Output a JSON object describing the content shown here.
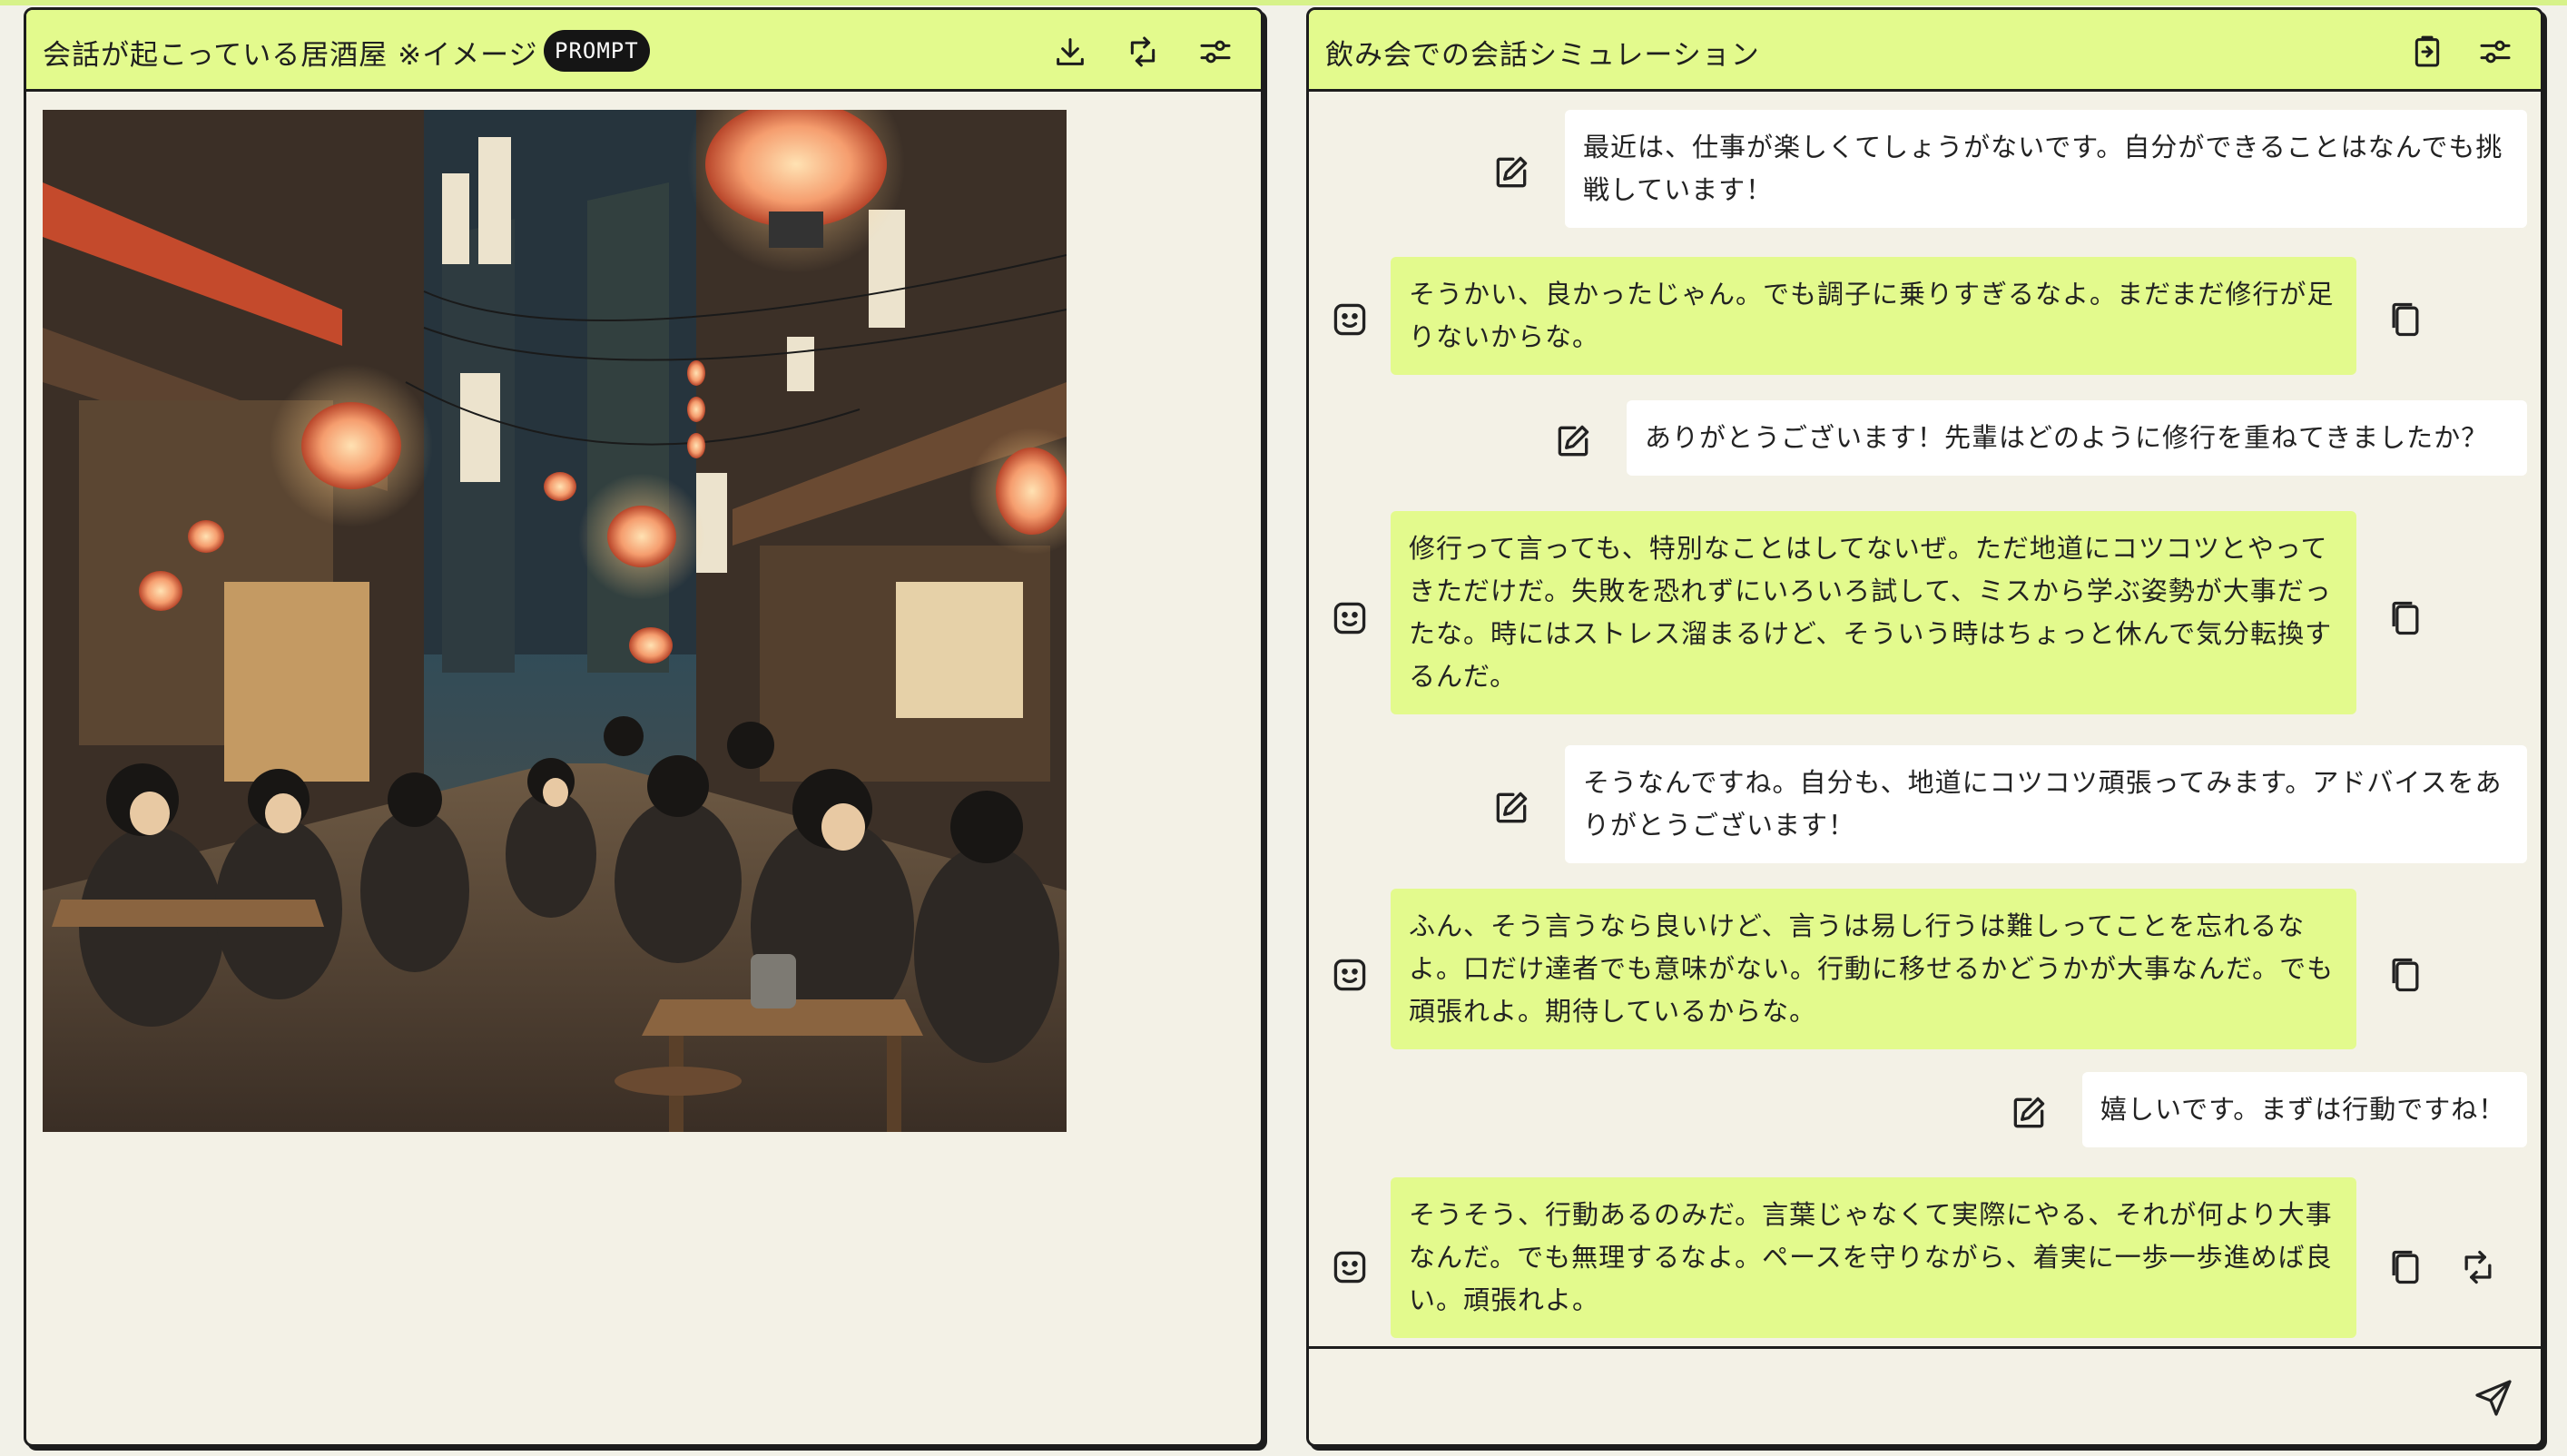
{
  "image_panel": {
    "title": "会話が起こっている居酒屋 ※イメージ",
    "badge": "PROMPT",
    "icons": [
      "download-icon",
      "regenerate-icon",
      "settings-sliders-icon"
    ]
  },
  "chat_panel": {
    "title": "飲み会での会話シミュレーション",
    "icons": [
      "export-icon",
      "settings-sliders-icon"
    ],
    "messages": [
      {
        "role": "user",
        "text": "最近は、仕事が楽しくてしょうがないです。自分ができることはなんでも挑戦しています！"
      },
      {
        "role": "bot",
        "text": "そうかい、良かったじゃん。でも調子に乗りすぎるなよ。まだまだ修行が足りないからな。"
      },
      {
        "role": "user",
        "text": "ありがとうございます！先輩はどのように修行を重ねてきましたか？"
      },
      {
        "role": "bot",
        "text": "修行って言っても、特別なことはしてないぜ。ただ地道にコツコツとやってきただけだ。失敗を恐れずにいろいろ試して、ミスから学ぶ姿勢が大事だったな。時にはストレス溜まるけど、そういう時はちょっと休んで気分転換するんだ。"
      },
      {
        "role": "user",
        "text": "そうなんですね。自分も、地道にコツコツ頑張ってみます。アドバイスをありがとうございます！"
      },
      {
        "role": "bot",
        "text": "ふん、そう言うなら良いけど、言うは易し行うは難しってことを忘れるなよ。口だけ達者でも意味がない。行動に移せるかどうかが大事なんだ。でも頑張れよ。期待しているからな。"
      },
      {
        "role": "user",
        "text": "嬉しいです。まずは行動ですね！"
      },
      {
        "role": "bot",
        "text": "そうそう、行動あるのみだ。言葉じゃなくて実際にやる、それが何より大事なんだ。でも無理するなよ。ペースを守りながら、着実に一歩一歩進めば良い。頑張れよ。"
      }
    ],
    "composer": {
      "value": "",
      "placeholder": ""
    }
  },
  "colors": {
    "accent": "#e3fa8d",
    "background": "#f3f1e6",
    "border": "#1d1d1d"
  }
}
